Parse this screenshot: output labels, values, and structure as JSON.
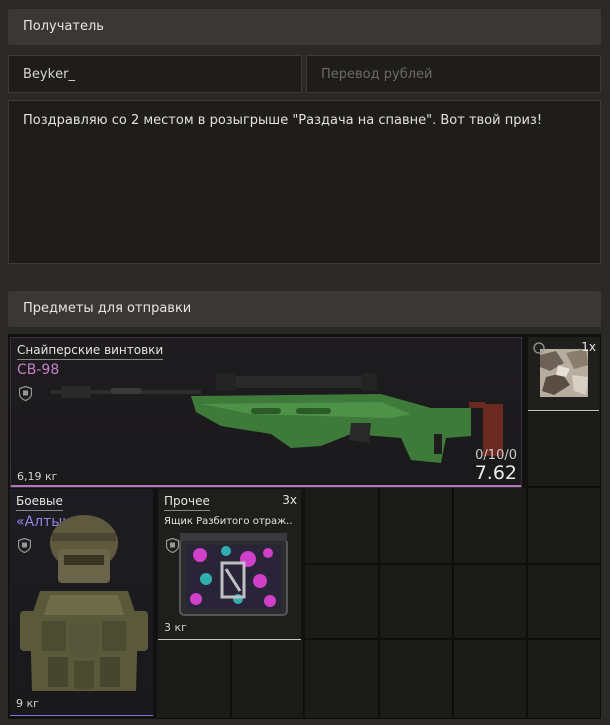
{
  "recipient_section": {
    "title": "Получатель"
  },
  "recipient_input": {
    "value": "Beykеr_",
    "placeholder": ""
  },
  "transfer_input": {
    "value": "",
    "placeholder": "Перевод рублей"
  },
  "message": {
    "text": "Поздравляю со 2 местом в розыгрыше \"Раздача на спавне\". Вот твой приз!"
  },
  "items_section": {
    "title": "Предметы для отправки"
  },
  "items": {
    "sniper": {
      "category": "Снайперские винтовки",
      "name": "СВ-98",
      "weight": "6,19 кг",
      "durability": "0/10/0",
      "caliber": "7.62",
      "name_color": "#c880c8"
    },
    "camo": {
      "count": "1x"
    },
    "armor": {
      "category": "Боевые",
      "name": "«Алтын»",
      "weight": "9 кг",
      "name_color": "#8f86e8"
    },
    "other": {
      "category": "Прочее",
      "count": "3x",
      "name": "Ящик Разбитого отраж..",
      "weight": "3 кг"
    }
  },
  "colors": {
    "header_bg": "#3a3835",
    "page_bg": "#2b2926",
    "rare_purple": "#b07ab8",
    "epic_blue": "#7d74d8"
  }
}
